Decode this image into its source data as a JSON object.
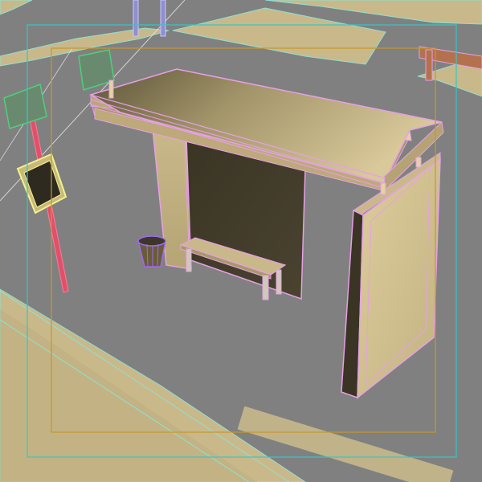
{
  "viewport": {
    "background_color": "#808080",
    "safe_frame_outer_color": "#35c6c6",
    "safe_frame_inner_color": "#c8962c",
    "wireframe_edge_color": "#e6a0e6",
    "ground_tile_color": "#c9b98a",
    "road_line_color": "#8fe0d0"
  },
  "objects": [
    "ground-tiles",
    "bus-shelter",
    "shelter-roof",
    "shelter-back-panel",
    "shelter-left-panel",
    "shelter-side-panel",
    "shelter-bench",
    "trash-bin",
    "sign-pole",
    "street-sign",
    "fence"
  ]
}
